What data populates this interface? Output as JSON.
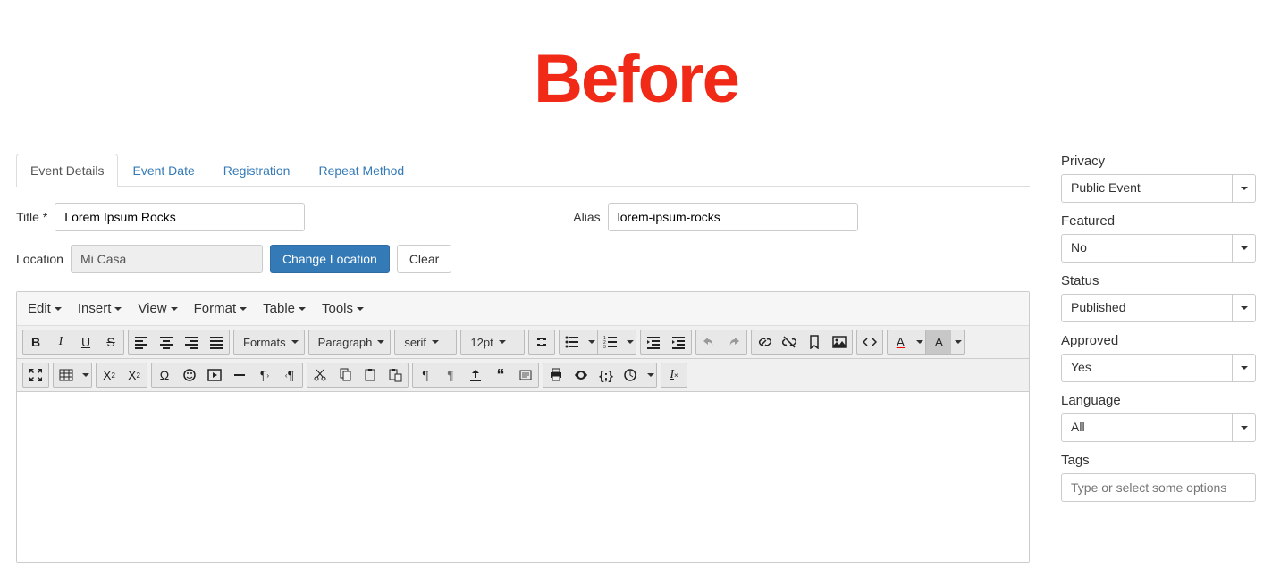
{
  "heading_text": "Before",
  "tabs": {
    "details": "Event Details",
    "date": "Event Date",
    "registration": "Registration",
    "repeat": "Repeat Method"
  },
  "form": {
    "title_label": "Title *",
    "title_value": "Lorem Ipsum Rocks",
    "alias_label": "Alias",
    "alias_value": "lorem-ipsum-rocks",
    "location_label": "Location",
    "location_value": "Mi Casa",
    "change_location": "Change Location",
    "clear": "Clear"
  },
  "editor": {
    "menubar": {
      "edit": "Edit",
      "insert": "Insert",
      "view": "View",
      "format": "Format",
      "table": "Table",
      "tools": "Tools"
    },
    "toolbar": {
      "formats": "Formats",
      "paragraph": "Paragraph",
      "fontfamily": "serif",
      "fontsize": "12pt",
      "textcolor_letter": "A",
      "bgcolor_letter": "A"
    }
  },
  "sidebar": {
    "privacy_label": "Privacy",
    "privacy_value": "Public Event",
    "featured_label": "Featured",
    "featured_value": "No",
    "status_label": "Status",
    "status_value": "Published",
    "approved_label": "Approved",
    "approved_value": "Yes",
    "language_label": "Language",
    "language_value": "All",
    "tags_label": "Tags",
    "tags_placeholder": "Type or select some options"
  }
}
